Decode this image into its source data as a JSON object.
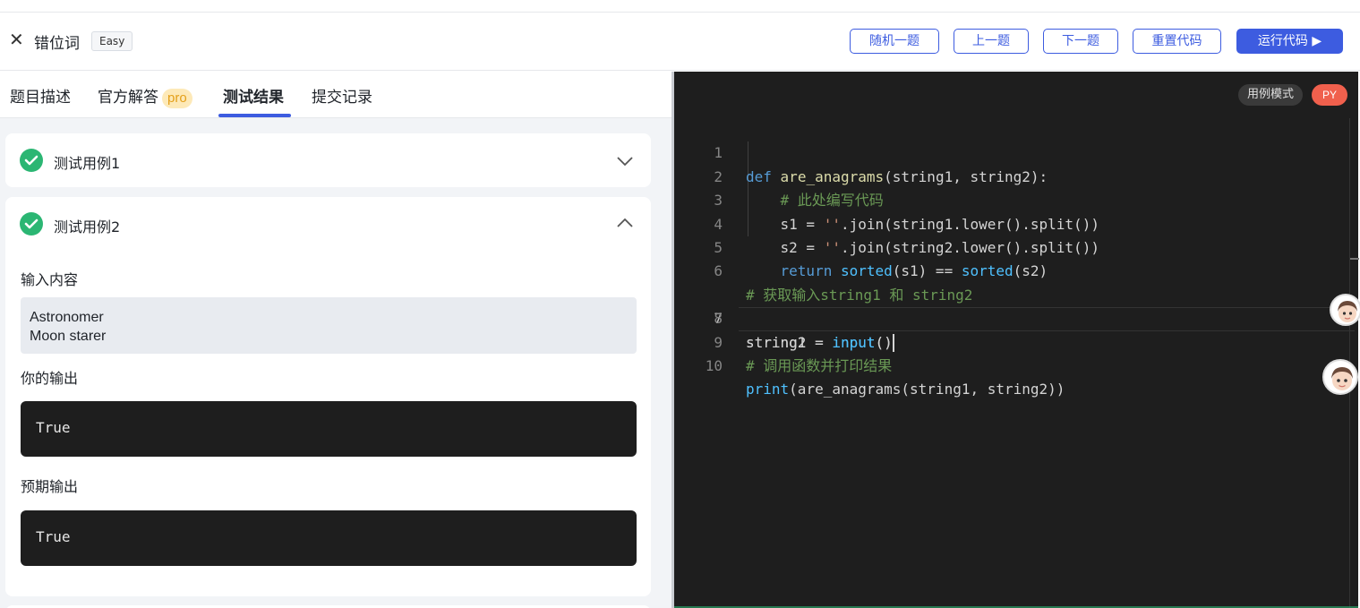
{
  "header": {
    "close_icon": "close-icon",
    "title": "错位词",
    "difficulty": "Easy",
    "buttons": {
      "random": "随机一题",
      "prev": "上一题",
      "next": "下一题",
      "reset": "重置代码",
      "run": "运行代码 ▶"
    },
    "accent_color": "#3d5ce0"
  },
  "tabs": [
    {
      "label": "题目描述"
    },
    {
      "label": "官方解答",
      "badge": "pro"
    },
    {
      "label": "测试结果",
      "active": true
    },
    {
      "label": "提交记录"
    }
  ],
  "results": {
    "case1": {
      "title": "测试用例1",
      "status": "passed",
      "expanded": false
    },
    "case2": {
      "title": "测试用例2",
      "status": "passed",
      "expanded": true,
      "input_label": "输入内容",
      "input_lines": [
        "Astronomer",
        "Moon starer"
      ],
      "output_label": "你的输出",
      "output": "True",
      "expected_label": "预期输出",
      "expected": "True"
    },
    "pass_color": "#2bb673"
  },
  "editor": {
    "mode_badge": "用例模式",
    "lang_badge": "PY",
    "current_line": 7,
    "line_numbers": [
      "1",
      "2",
      "3",
      "4",
      "5",
      "6",
      "7",
      "8",
      "9",
      "10"
    ],
    "lines": [
      "def are_anagrams(string1, string2):",
      "    # 此处编写代码",
      "    s1 = ''.join(string1.lower().split())",
      "    s2 = ''.join(string2.lower().split())",
      "    return sorted(s1) == sorted(s2)",
      "# 获取输入string1 和 string2",
      "string1 = input()",
      "string2 = input()",
      "# 调用函数并打印结果",
      "print(are_anagrams(string1, string2))"
    ]
  }
}
